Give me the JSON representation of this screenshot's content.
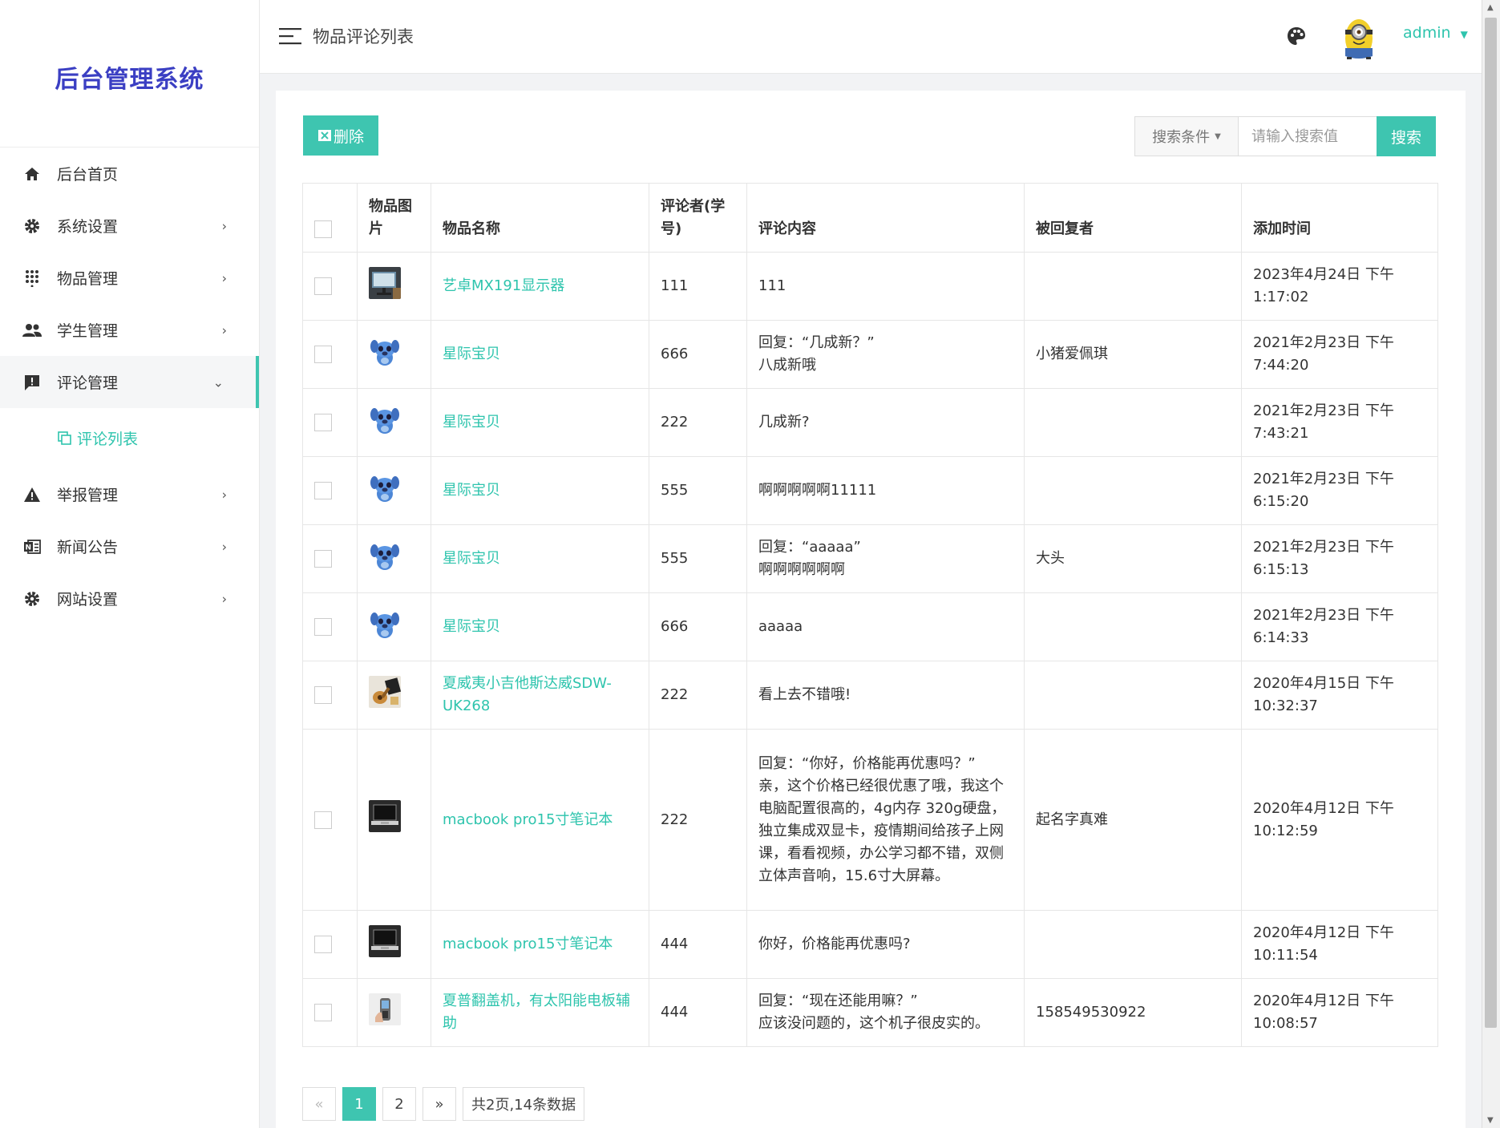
{
  "brand": {
    "title": "后台管理系统"
  },
  "header": {
    "page_title": "物品评论列表",
    "username": "admin"
  },
  "sidebar": {
    "items": [
      {
        "label": "后台首页",
        "icon": "home-icon"
      },
      {
        "label": "系统设置",
        "icon": "gear-icon"
      },
      {
        "label": "物品管理",
        "icon": "grid-dots-icon"
      },
      {
        "label": "学生管理",
        "icon": "users-icon"
      },
      {
        "label": "评论管理",
        "icon": "comment-icon",
        "expanded": true
      },
      {
        "label": "举报管理",
        "icon": "warning-icon"
      },
      {
        "label": "新闻公告",
        "icon": "news-icon"
      },
      {
        "label": "网站设置",
        "icon": "gear-icon"
      }
    ],
    "sub_item": {
      "label": "评论列表",
      "icon": "copy-icon"
    }
  },
  "toolbar": {
    "delete_label": "删除",
    "search_condition_label": "搜索条件",
    "search_placeholder": "请输入搜索值",
    "search_label": "搜索"
  },
  "table": {
    "headers": {
      "image": "物品图片",
      "name": "物品名称",
      "commenter": "评论者(学号)",
      "content": "评论内容",
      "replied": "被回复者",
      "time": "添加时间"
    },
    "rows": [
      {
        "thumb": "monitor",
        "name": "艺卓MX191显示器",
        "commenter": "111",
        "content": "111",
        "replied": "",
        "time": "2023年4月24日 下午1:17:02"
      },
      {
        "thumb": "stitch",
        "name": "星际宝贝",
        "commenter": "666",
        "content": "回复：“几成新？”\n八成新哦",
        "replied": "小猪爱佩琪",
        "time": "2021年2月23日 下午7:44:20"
      },
      {
        "thumb": "stitch",
        "name": "星际宝贝",
        "commenter": "222",
        "content": "几成新?",
        "replied": "",
        "time": "2021年2月23日 下午7:43:21"
      },
      {
        "thumb": "stitch",
        "name": "星际宝贝",
        "commenter": "555",
        "content": "啊啊啊啊啊11111",
        "replied": "",
        "time": "2021年2月23日 下午6:15:20"
      },
      {
        "thumb": "stitch",
        "name": "星际宝贝",
        "commenter": "555",
        "content": "回复：“aaaaa”\n啊啊啊啊啊啊",
        "replied": "大头",
        "time": "2021年2月23日 下午6:15:13"
      },
      {
        "thumb": "stitch",
        "name": "星际宝贝",
        "commenter": "666",
        "content": "aaaaa",
        "replied": "",
        "time": "2021年2月23日 下午6:14:33"
      },
      {
        "thumb": "ukulele",
        "name": "夏威夷小吉他斯达威SDW-UK268",
        "commenter": "222",
        "content": "看上去不错哦!",
        "replied": "",
        "time": "2020年4月15日 下午10:32:37"
      },
      {
        "thumb": "laptop",
        "name": "macbook pro15寸笔记本",
        "commenter": "222",
        "content": "回复：“你好，价格能再优惠吗？”\n亲，这个价格已经很优惠了哦，我这个电脑配置很高的，4g内存 320g硬盘，独立集成双显卡，疫情期间给孩子上网课，看看视频，办公学习都不错，双侧立体声音响，15.6寸大屏幕。",
        "replied": "起名字真难",
        "time": "2020年4月12日 下午10:12:59"
      },
      {
        "thumb": "laptop",
        "name": "macbook pro15寸笔记本",
        "commenter": "444",
        "content": "你好，价格能再优惠吗?",
        "replied": "",
        "time": "2020年4月12日 下午10:11:54"
      },
      {
        "thumb": "phone",
        "name": "夏普翻盖机，有太阳能电板辅助",
        "commenter": "444",
        "content": "回复：“现在还能用嘛？”\n应该没问题的，这个机子很皮实的。",
        "replied": "158549530922",
        "time": "2020年4月12日 下午10:08:57"
      }
    ]
  },
  "pagination": {
    "prev": "«",
    "pages": [
      "1",
      "2"
    ],
    "current": "1",
    "next": "»",
    "summary": "共2页,14条数据"
  },
  "colors": {
    "accent": "#3ec5b0",
    "brand": "#3b3fc3",
    "time": "#1fb25a"
  }
}
